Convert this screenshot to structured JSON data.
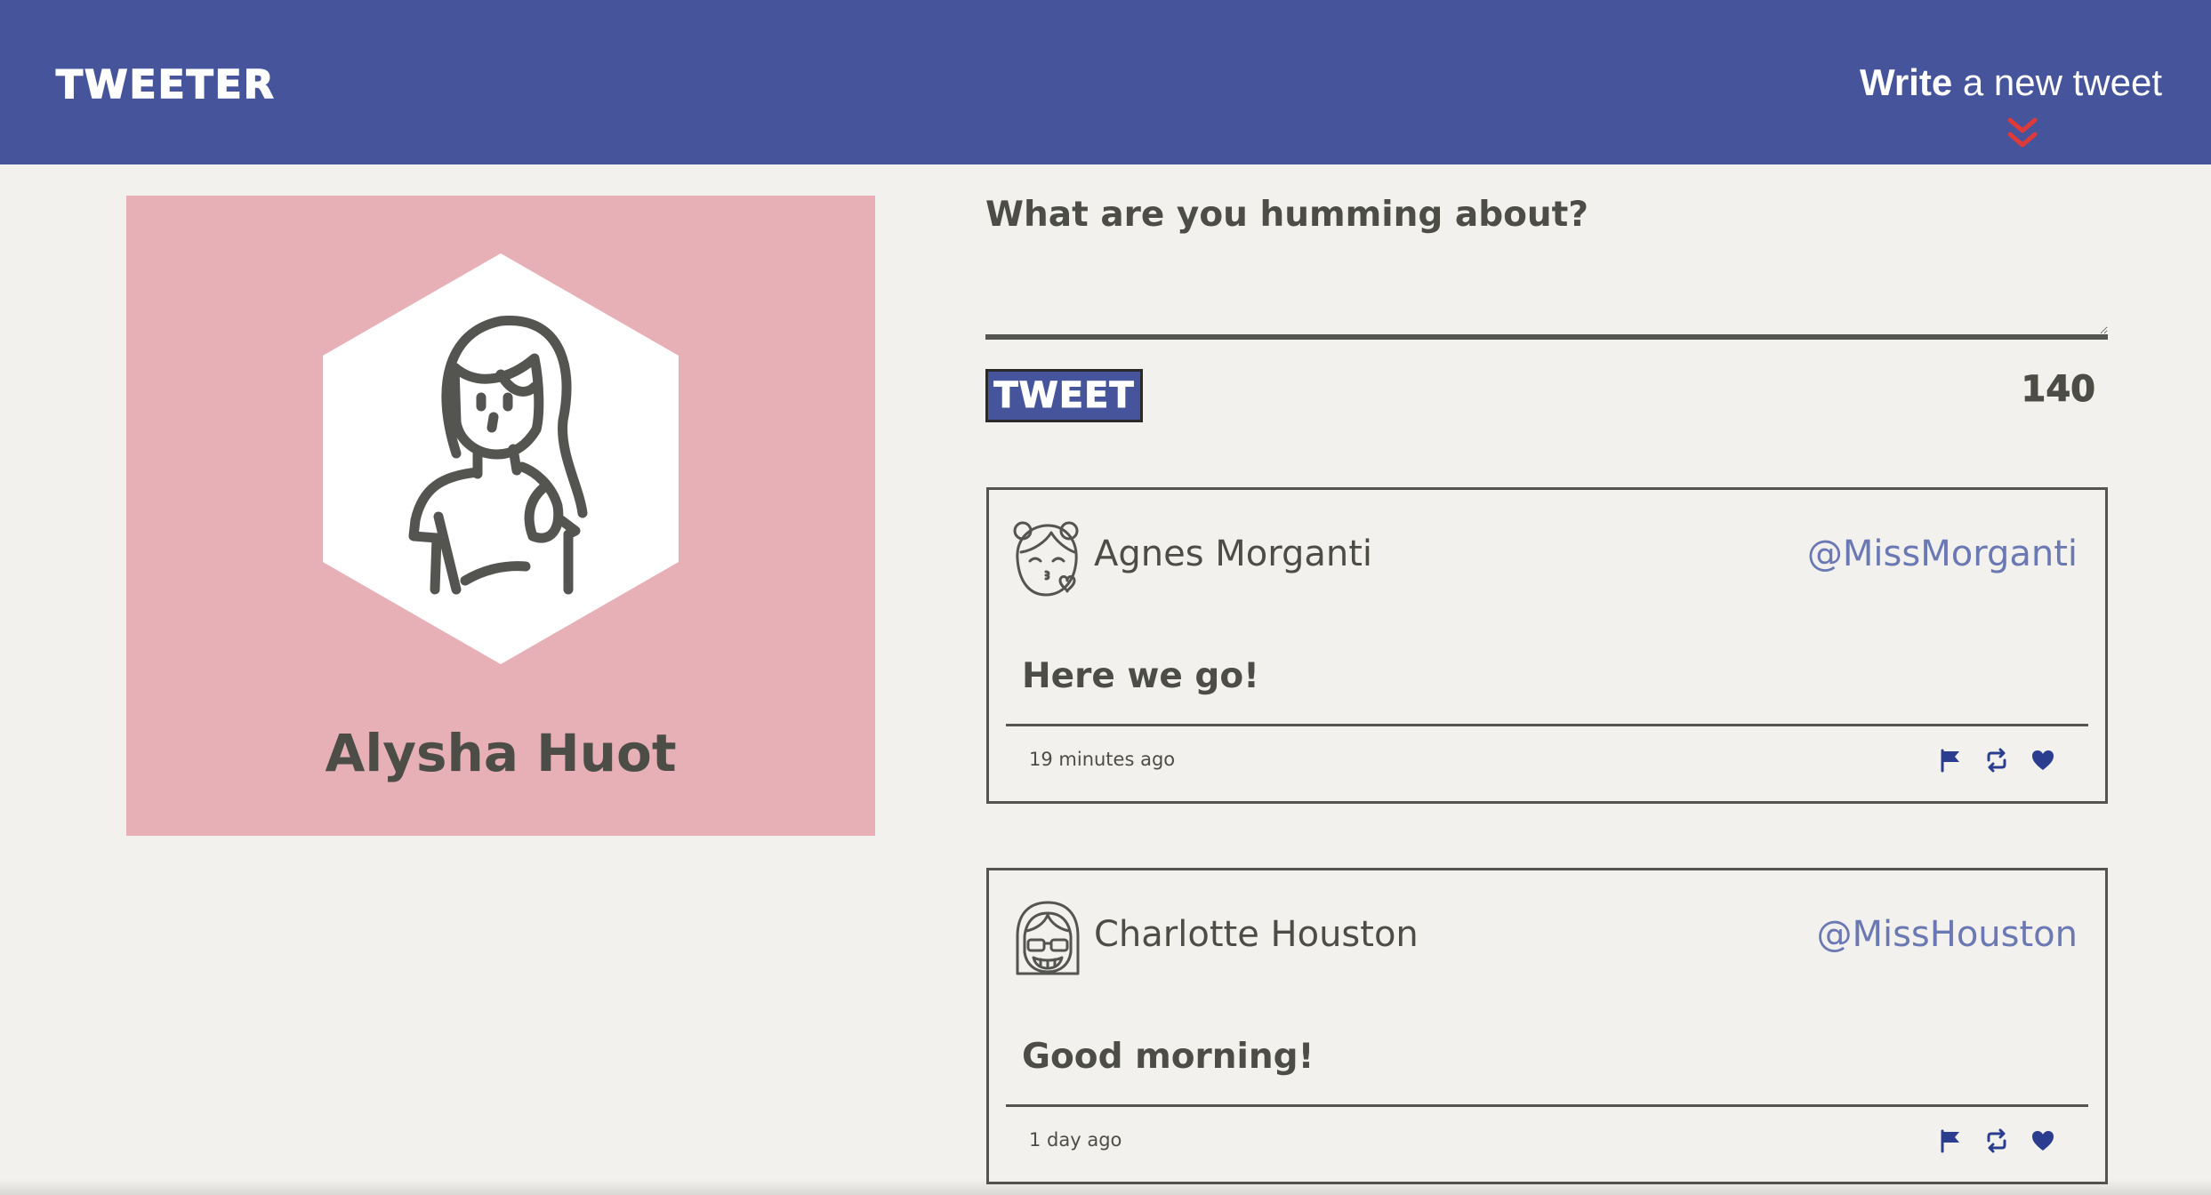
{
  "nav": {
    "brand": "TWEETER",
    "compose_bold": "Write",
    "compose_rest": " a new tweet",
    "chevron_icon": "double-chevron-down-icon",
    "accent_color": "#e0393a",
    "background_color": "#46559b"
  },
  "profile": {
    "name": "Alysha Huot",
    "avatar_icon": "woman-avatar-icon",
    "background_color": "#e6b0b6"
  },
  "composer": {
    "label": "What are you humming about?",
    "value": "",
    "button_label": "TWEET",
    "counter": "140"
  },
  "tweets": [
    {
      "avatar_icon": "girl-kissing-avatar-icon",
      "author": "Agnes Morganti",
      "handle": "@MissMorganti",
      "body": "Here we go!",
      "time": "19 minutes ago",
      "actions": [
        "flag-icon",
        "retweet-icon",
        "heart-icon"
      ]
    },
    {
      "avatar_icon": "girl-glasses-avatar-icon",
      "author": "Charlotte Houston",
      "handle": "@MissHouston",
      "body": "Good morning!",
      "time": "1 day ago",
      "actions": [
        "flag-icon",
        "retweet-icon",
        "heart-icon"
      ]
    }
  ]
}
